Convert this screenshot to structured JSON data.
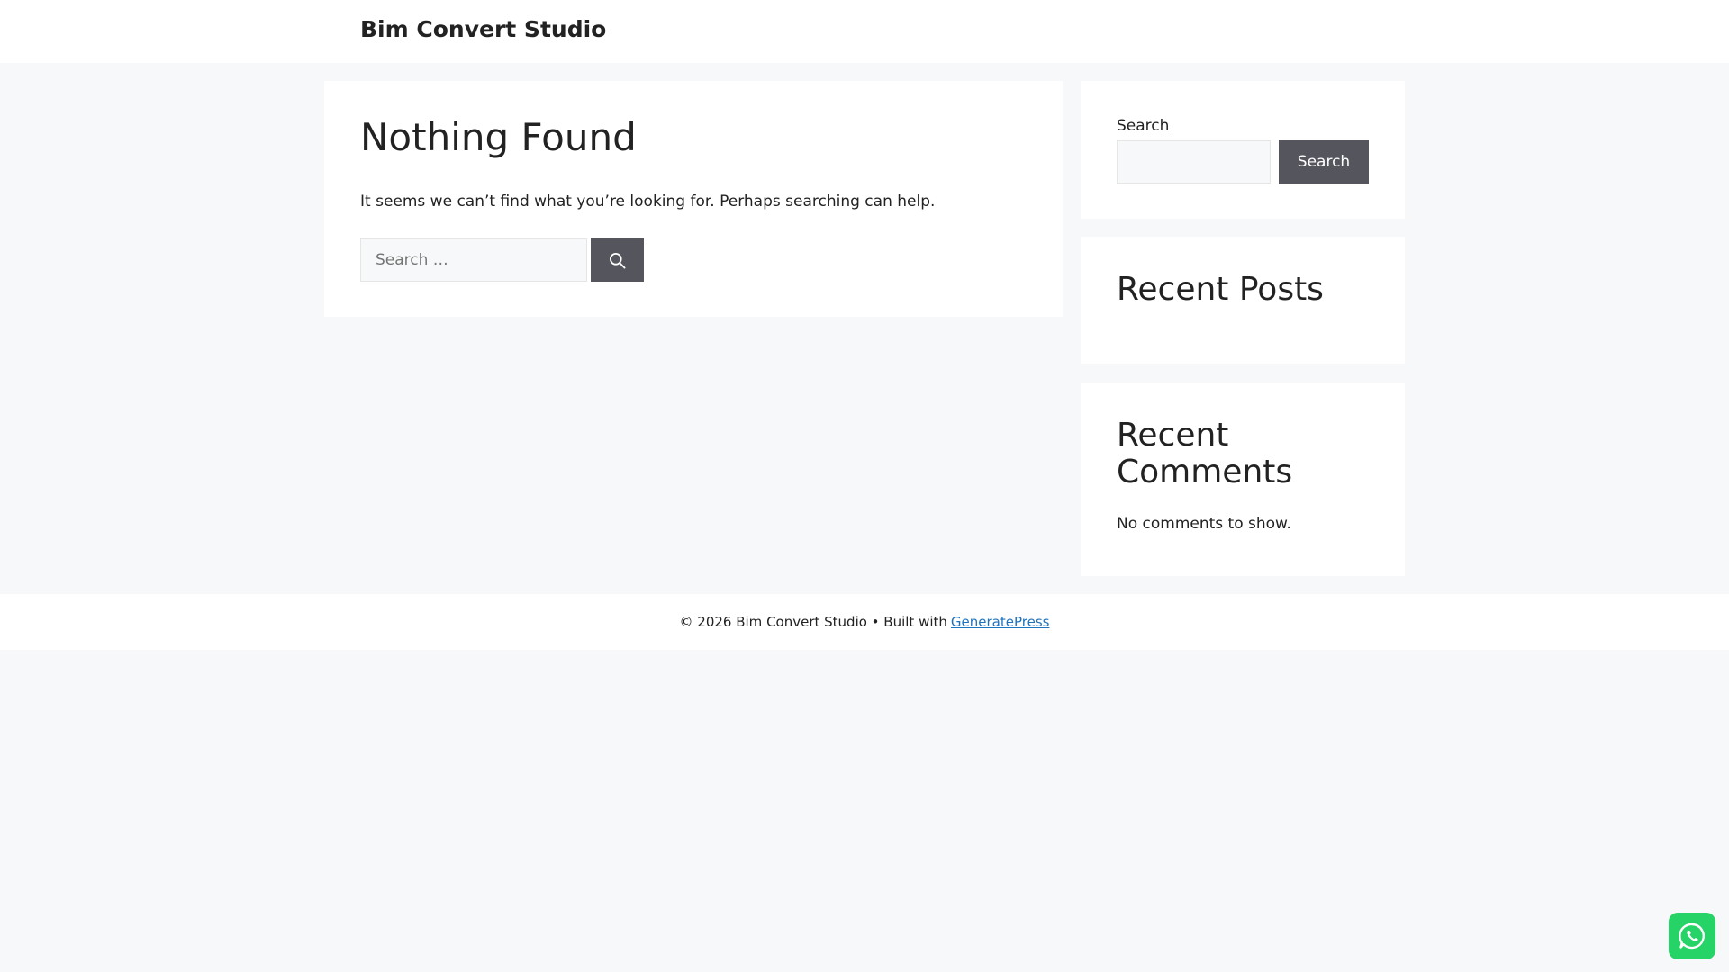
{
  "header": {
    "site_title": "Bim Convert Studio"
  },
  "main": {
    "title": "Nothing Found",
    "message": "It seems we can’t find what you’re looking for. Perhaps searching can help.",
    "search": {
      "placeholder": "Search …",
      "value": "",
      "submit_icon": "search-icon"
    }
  },
  "sidebar": {
    "search_widget": {
      "label": "Search",
      "value": "",
      "button_label": "Search"
    },
    "recent_posts": {
      "title": "Recent Posts"
    },
    "recent_comments": {
      "title": "Recent Comments",
      "empty_text": "No comments to show."
    }
  },
  "footer": {
    "text": "© 2026 Bim Convert Studio • Built with",
    "link_text": "GeneratePress"
  },
  "floating": {
    "icon": "whatsapp-icon"
  },
  "colors": {
    "background": "#f7f8f9",
    "button": "#55555e",
    "link": "#1e73be",
    "whatsapp": "#25d366"
  }
}
